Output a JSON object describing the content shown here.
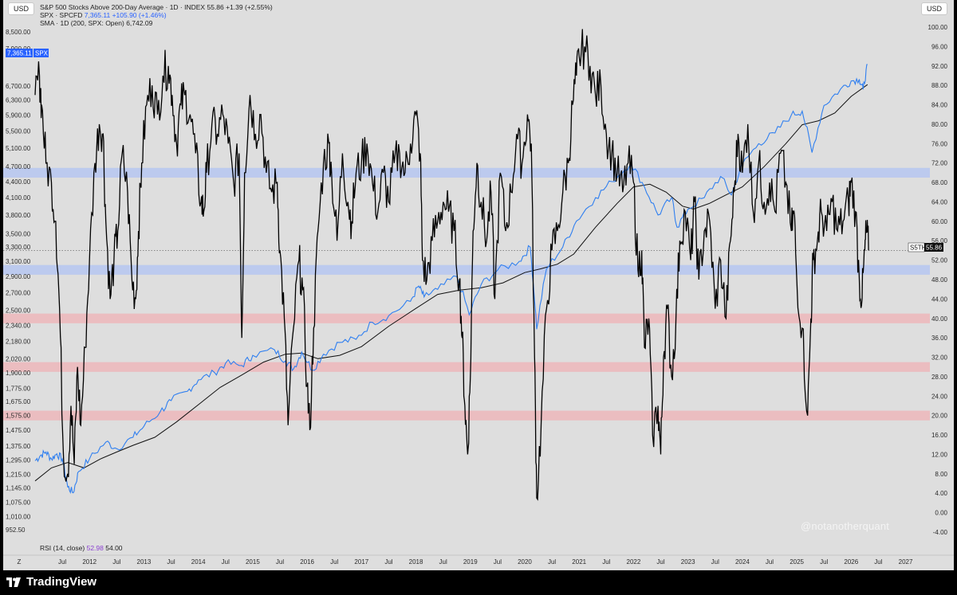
{
  "header": {
    "usd_left": "USD",
    "usd_right": "USD",
    "legend_line1": "S&P 500 Stocks Above 200-Day Average · 1D · INDEX",
    "legend_line1_values": "55.86 +1.39 (+2.55%)",
    "legend_line2_name": "SPX · SPCFD",
    "legend_line2_values": "7,365.11 +105.90 (+1.46%)",
    "legend_line3": "SMA · 1D (200, SPX: Open)",
    "legend_line3_value": "6,742.09"
  },
  "tags": {
    "spx_value": "7,365.11",
    "spx_label": "SPX",
    "s5th_label": "S5TH",
    "s5th_value": "55.86"
  },
  "rsi": {
    "label": "RSI (14, close)",
    "value1": "52.98",
    "value2": "54.00"
  },
  "watermark": "@notanotherquant",
  "footer": {
    "brand": "TradingView"
  },
  "colors": {
    "background": "#dedede",
    "breadth_line": "#000000",
    "spx_line": "#2f7ff0",
    "sma_line": "#111111",
    "blue_band": "#b8c8f0",
    "red_band": "#ecb9bd",
    "spx_tag": "#2962ff"
  },
  "chart_data": {
    "type": "line",
    "title": "S&P 500 Stocks Above 200-Day Average · 1D · INDEX",
    "left_axis": {
      "scale": "log",
      "ticks": [
        8500,
        7900,
        7365.11,
        6700,
        6300,
        5900,
        5500,
        5100,
        4700,
        4400,
        4100,
        3800,
        3500,
        3300,
        3100,
        2900,
        2700,
        2500,
        2340,
        2180,
        2020,
        1900,
        1775,
        1675,
        1575,
        1475,
        1375,
        1295,
        1215,
        1145,
        1075,
        1010,
        952.5
      ],
      "tick_labels": [
        "8,500.00",
        "7,900.00",
        "7,365.11",
        "6,700.00",
        "6,300.00",
        "5,900.00",
        "5,500.00",
        "5,100.00",
        "4,700.00",
        "4,400.00",
        "4,100.00",
        "3,800.00",
        "3,500.00",
        "3,300.00",
        "3,100.00",
        "2,900.00",
        "2,700.00",
        "2,500.00",
        "2,340.00",
        "2,180.00",
        "2,020.00",
        "1,900.00",
        "1,775.00",
        "1,675.00",
        "1,575.00",
        "1,475.00",
        "1,375.00",
        "1,295.00",
        "1,215.00",
        "1,145.00",
        "1,075.00",
        "1,010.00",
        "952.50"
      ]
    },
    "right_axis": {
      "range": [
        -4,
        100
      ],
      "ticks": [
        100,
        96,
        92,
        88,
        84,
        80,
        76,
        72,
        68,
        64,
        60,
        56,
        52,
        48,
        44,
        40,
        36,
        32,
        28,
        24,
        20,
        16,
        12,
        8,
        4,
        0,
        -4
      ],
      "tick_labels": [
        "100.00",
        "96.00",
        "92.00",
        "88.00",
        "84.00",
        "80.00",
        "76.00",
        "72.00",
        "68.00",
        "64.00",
        "60.00",
        "56.00",
        "52.00",
        "48.00",
        "44.00",
        "40.00",
        "36.00",
        "32.00",
        "28.00",
        "24.00",
        "20.00",
        "16.00",
        "12.00",
        "8.00",
        "4.00",
        "0.00",
        "-4.00"
      ]
    },
    "x_axis": {
      "labels": [
        "Z",
        "Jul",
        "2012",
        "Jul",
        "2013",
        "Jul",
        "2014",
        "Jul",
        "2015",
        "Jul",
        "2016",
        "Jul",
        "2017",
        "Jul",
        "2018",
        "Jul",
        "2019",
        "Jul",
        "2020",
        "Jul",
        "2021",
        "Jul",
        "2022",
        "Jul",
        "2023",
        "Jul",
        "2024",
        "Jul",
        "2025",
        "Jul",
        "2026",
        "Jul",
        "2027"
      ],
      "label_years": [
        2011.05,
        2011.5,
        2012.0,
        2012.5,
        2013.0,
        2013.5,
        2014.0,
        2014.5,
        2015.0,
        2015.5,
        2016.0,
        2016.5,
        2017.0,
        2017.5,
        2018.0,
        2018.5,
        2019.0,
        2019.5,
        2020.0,
        2020.5,
        2021.0,
        2021.5,
        2022.0,
        2022.5,
        2023.0,
        2023.5,
        2024.0,
        2024.5,
        2025.0,
        2025.5,
        2026.0,
        2026.5,
        2027.0
      ],
      "range": [
        2011.0,
        2027.3
      ]
    },
    "bands": [
      {
        "color": "blue",
        "from": 69,
        "to": 71
      },
      {
        "color": "blue",
        "from": 49,
        "to": 51
      },
      {
        "color": "red",
        "from": 39,
        "to": 41
      },
      {
        "color": "red",
        "from": 29,
        "to": 31
      },
      {
        "color": "red",
        "from": 19,
        "to": 21
      }
    ],
    "series": [
      {
        "name": "S&P 500 Stocks Above 200-Day Average",
        "axis": "right",
        "x": [
          2011.0,
          2011.08,
          2011.12,
          2011.2,
          2011.3,
          2011.38,
          2011.45,
          2011.52,
          2011.6,
          2011.66,
          2011.72,
          2011.78,
          2011.84,
          2011.92,
          2012.0,
          2012.1,
          2012.18,
          2012.25,
          2012.3,
          2012.38,
          2012.45,
          2012.52,
          2012.6,
          2012.7,
          2012.78,
          2012.85,
          2012.9,
          2012.96,
          2013.05,
          2013.15,
          2013.25,
          2013.35,
          2013.45,
          2013.52,
          2013.6,
          2013.68,
          2013.75,
          2013.85,
          2013.95,
          2014.05,
          2014.1,
          2014.15,
          2014.25,
          2014.35,
          2014.45,
          2014.55,
          2014.65,
          2014.75,
          2014.8,
          2014.85,
          2014.95,
          2015.05,
          2015.15,
          2015.25,
          2015.35,
          2015.45,
          2015.5,
          2015.58,
          2015.65,
          2015.75,
          2015.85,
          2015.92,
          2016.0,
          2016.05,
          2016.12,
          2016.2,
          2016.3,
          2016.4,
          2016.45,
          2016.55,
          2016.65,
          2016.75,
          2016.82,
          2016.9,
          2017.0,
          2017.1,
          2017.2,
          2017.3,
          2017.4,
          2017.5,
          2017.6,
          2017.7,
          2017.8,
          2017.9,
          2018.0,
          2018.08,
          2018.12,
          2018.2,
          2018.3,
          2018.4,
          2018.5,
          2018.6,
          2018.7,
          2018.8,
          2018.85,
          2018.9,
          2018.95,
          2019.0,
          2019.05,
          2019.12,
          2019.2,
          2019.3,
          2019.38,
          2019.45,
          2019.55,
          2019.65,
          2019.75,
          2019.85,
          2019.95,
          2020.05,
          2020.12,
          2020.18,
          2020.22,
          2020.3,
          2020.4,
          2020.5,
          2020.6,
          2020.7,
          2020.8,
          2020.88,
          2020.95,
          2021.0,
          2021.1,
          2021.2,
          2021.3,
          2021.4,
          2021.5,
          2021.6,
          2021.7,
          2021.8,
          2021.9,
          2022.0,
          2022.08,
          2022.15,
          2022.2,
          2022.28,
          2022.35,
          2022.45,
          2022.5,
          2022.55,
          2022.62,
          2022.7,
          2022.78,
          2022.85,
          2022.95,
          2023.05,
          2023.12,
          2023.2,
          2023.3,
          2023.4,
          2023.5,
          2023.6,
          2023.7,
          2023.78,
          2023.85,
          2023.92,
          2024.0,
          2024.1,
          2024.2,
          2024.3,
          2024.4,
          2024.5,
          2024.6,
          2024.7,
          2024.8,
          2024.9,
          2024.95,
          2025.0,
          2025.1,
          2025.2,
          2025.26,
          2025.3,
          2025.38,
          2025.45,
          2025.55,
          2025.65,
          2025.75,
          2025.85,
          2025.95,
          2026.0,
          2026.08,
          2026.15,
          2026.2,
          2026.25,
          2026.28,
          2026.32
        ],
        "values": [
          86,
          90,
          84,
          72,
          68,
          60,
          42,
          12,
          8,
          22,
          10,
          30,
          18,
          34,
          52,
          72,
          80,
          78,
          60,
          44,
          52,
          58,
          74,
          66,
          48,
          44,
          58,
          72,
          84,
          88,
          82,
          90,
          92,
          86,
          76,
          84,
          86,
          82,
          74,
          64,
          62,
          70,
          80,
          78,
          82,
          76,
          68,
          74,
          36,
          70,
          86,
          78,
          82,
          70,
          66,
          68,
          54,
          40,
          18,
          38,
          52,
          46,
          26,
          17,
          38,
          58,
          72,
          76,
          70,
          56,
          74,
          64,
          60,
          70,
          72,
          76,
          68,
          62,
          70,
          64,
          72,
          74,
          70,
          76,
          82,
          74,
          52,
          48,
          56,
          60,
          64,
          62,
          58,
          48,
          36,
          22,
          12,
          28,
          58,
          72,
          64,
          56,
          66,
          44,
          70,
          58,
          66,
          78,
          72,
          82,
          76,
          32,
          3,
          18,
          42,
          54,
          58,
          66,
          72,
          84,
          90,
          94,
          96,
          92,
          86,
          88,
          78,
          74,
          70,
          66,
          72,
          68,
          50,
          54,
          34,
          40,
          16,
          22,
          12,
          32,
          42,
          28,
          40,
          56,
          62,
          52,
          64,
          48,
          58,
          60,
          42,
          52,
          40,
          56,
          66,
          78,
          70,
          80,
          62,
          72,
          64,
          68,
          62,
          74,
          68,
          58,
          62,
          48,
          38,
          20,
          40,
          52,
          56,
          62,
          58,
          64,
          58,
          60,
          64,
          68,
          62,
          48,
          44,
          54,
          58,
          54
        ]
      },
      {
        "name": "SPX · SPCFD",
        "axis": "left",
        "x": [
          2011.0,
          2011.1,
          2011.2,
          2011.3,
          2011.4,
          2011.5,
          2011.6,
          2011.7,
          2011.8,
          2012.0,
          2012.3,
          2012.5,
          2012.8,
          2013.0,
          2013.3,
          2013.5,
          2013.8,
          2014.0,
          2014.3,
          2014.5,
          2014.8,
          2015.0,
          2015.4,
          2015.6,
          2015.75,
          2015.9,
          2016.1,
          2016.3,
          2016.6,
          2016.9,
          2017.2,
          2017.5,
          2017.9,
          2018.05,
          2018.15,
          2018.4,
          2018.75,
          2018.98,
          2019.2,
          2019.5,
          2019.9,
          2020.1,
          2020.22,
          2020.4,
          2020.7,
          2020.95,
          2021.3,
          2021.6,
          2021.95,
          2022.2,
          2022.45,
          2022.7,
          2022.8,
          2023.0,
          2023.3,
          2023.6,
          2023.8,
          2024.0,
          2024.3,
          2024.6,
          2024.9,
          2025.1,
          2025.28,
          2025.5,
          2025.8,
          2026.0,
          2026.15,
          2026.22,
          2026.3
        ],
        "values": [
          1290,
          1320,
          1340,
          1300,
          1330,
          1300,
          1150,
          1120,
          1230,
          1300,
          1400,
          1360,
          1430,
          1500,
          1600,
          1680,
          1750,
          1840,
          1900,
          1980,
          1960,
          2050,
          2100,
          2000,
          1930,
          2080,
          1920,
          2060,
          2170,
          2200,
          2370,
          2440,
          2600,
          2780,
          2650,
          2740,
          2900,
          2450,
          2800,
          2980,
          3100,
          3300,
          2300,
          3000,
          3300,
          3700,
          4100,
          4400,
          4770,
          4300,
          3800,
          4100,
          3600,
          3900,
          4100,
          4500,
          4150,
          4750,
          5200,
          5450,
          5900,
          6000,
          5000,
          6150,
          6600,
          6850,
          6900,
          6600,
          7365.11
        ]
      },
      {
        "name": "SMA (200, SPX: Open)",
        "axis": "left",
        "x": [
          2011.0,
          2011.3,
          2011.6,
          2011.9,
          2012.2,
          2012.5,
          2012.8,
          2013.2,
          2013.6,
          2014.0,
          2014.4,
          2014.8,
          2015.2,
          2015.6,
          2015.9,
          2016.2,
          2016.6,
          2017.0,
          2017.5,
          2018.0,
          2018.4,
          2018.8,
          2019.2,
          2019.6,
          2020.0,
          2020.3,
          2020.6,
          2020.9,
          2021.3,
          2021.7,
          2022.0,
          2022.3,
          2022.6,
          2022.9,
          2023.1,
          2023.4,
          2023.7,
          2024.0,
          2024.4,
          2024.8,
          2025.1,
          2025.4,
          2025.7,
          2026.0,
          2026.3
        ],
        "values": [
          1180,
          1250,
          1280,
          1250,
          1300,
          1340,
          1380,
          1430,
          1530,
          1650,
          1780,
          1880,
          1990,
          2060,
          2070,
          2020,
          2050,
          2130,
          2330,
          2520,
          2680,
          2730,
          2760,
          2820,
          2950,
          3000,
          3060,
          3200,
          3600,
          4000,
          4300,
          4350,
          4200,
          3950,
          3900,
          4000,
          4150,
          4300,
          4700,
          5200,
          5650,
          5750,
          5950,
          6400,
          6742.09
        ]
      }
    ]
  }
}
